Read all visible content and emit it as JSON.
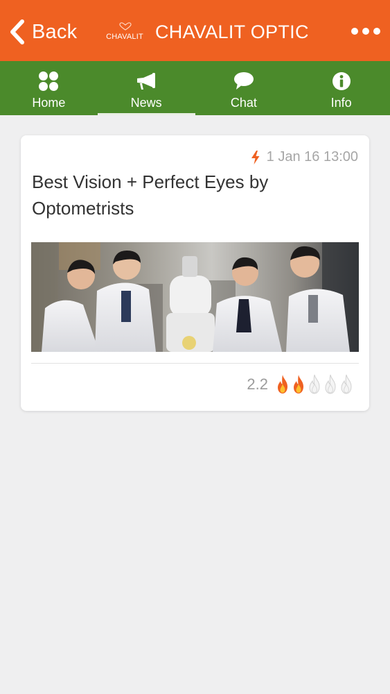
{
  "header": {
    "back_label": "Back",
    "logo_text": "CHAVALIT",
    "title": "CHAVALIT OPTIC",
    "more_icon": "more-dots-icon",
    "background": "#ef6121"
  },
  "tabs": [
    {
      "label": "Home",
      "icon": "grid-dots-icon",
      "active": false
    },
    {
      "label": "News",
      "icon": "megaphone-icon",
      "active": true
    },
    {
      "label": "Chat",
      "icon": "chat-bubble-icon",
      "active": false
    },
    {
      "label": "Info",
      "icon": "info-circle-icon",
      "active": false
    }
  ],
  "tab_bar_color": "#4b8a2b",
  "post": {
    "timestamp": "1 Jan 16 13:00",
    "title": "Best Vision + Perfect Eyes by Optometrists",
    "image_icon": "photo-optometrists",
    "rating": "2.2",
    "rating_value": 2.2,
    "rating_max": 5,
    "rating_icon": "flame-icon",
    "accent_color": "#ef6121"
  }
}
